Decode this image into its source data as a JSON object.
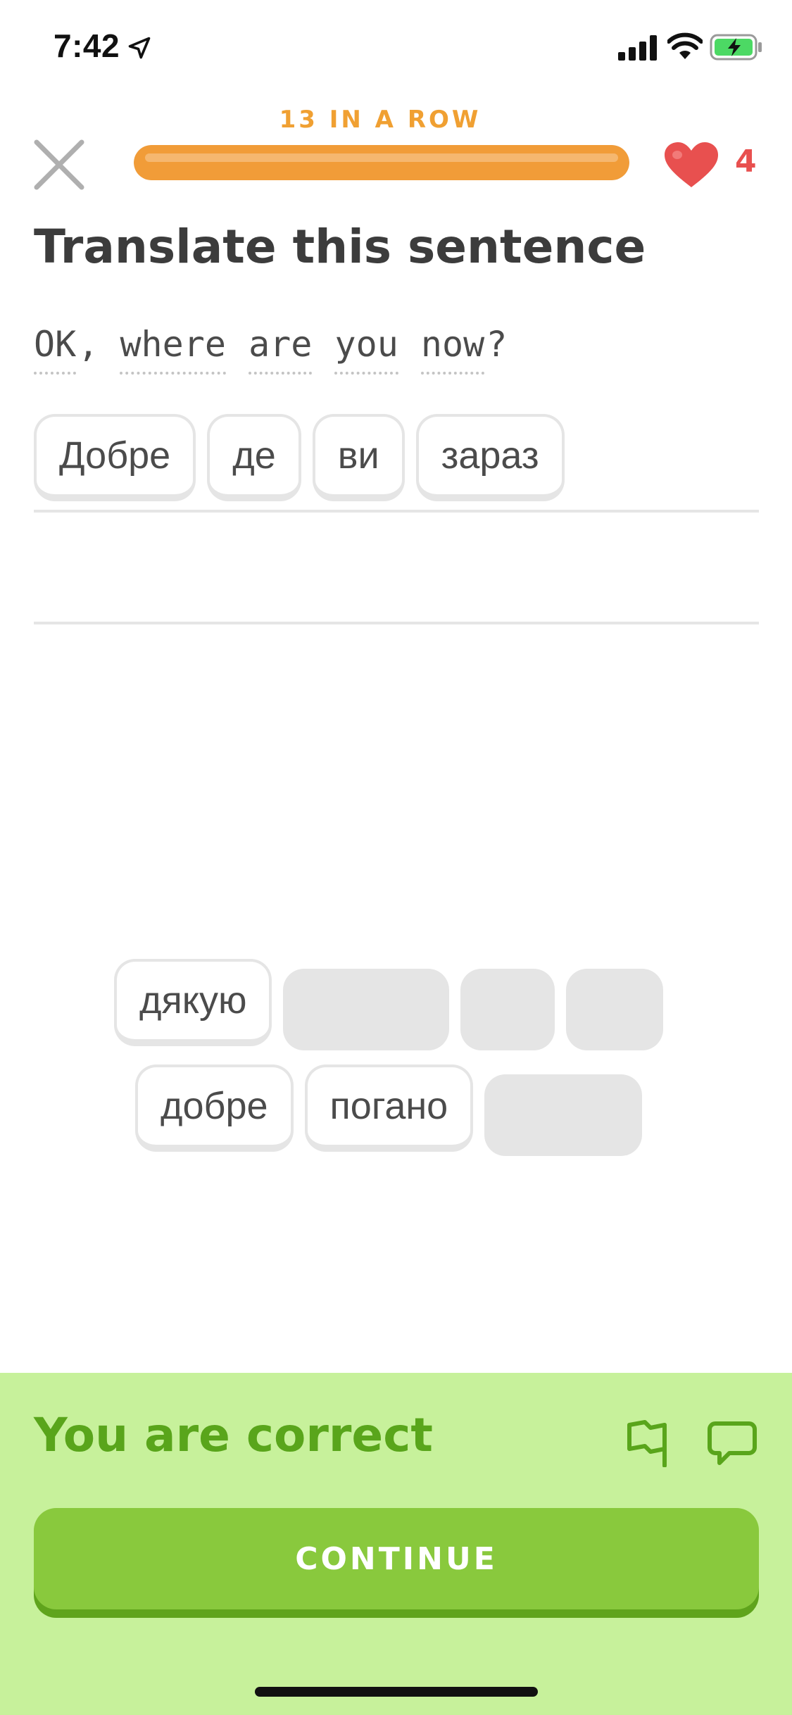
{
  "status_bar": {
    "time": "7:42",
    "icons": [
      "location-arrow-icon",
      "cellular-signal-icon",
      "wifi-icon",
      "battery-charging-icon"
    ]
  },
  "header": {
    "streak_text": "13 IN A ROW",
    "progress": 1.0,
    "hearts": "4",
    "colors": {
      "progress": "#f19c38",
      "streak": "#f0a032",
      "heart": "#e8504f"
    }
  },
  "prompt": {
    "title": "Translate this sentence",
    "sentence_words": [
      "OK",
      "where",
      "are",
      "you",
      "now"
    ],
    "sentence_punct": [
      ",",
      "?"
    ]
  },
  "answer": {
    "tiles": [
      "Добре",
      "де",
      "ви",
      "зараз"
    ]
  },
  "word_bank": {
    "row1": [
      {
        "text": "дякую",
        "used": false
      },
      {
        "text": "",
        "used": true
      },
      {
        "text": "",
        "used": true
      },
      {
        "text": "",
        "used": true
      }
    ],
    "row2": [
      {
        "text": "добре",
        "used": false
      },
      {
        "text": "погано",
        "used": false
      },
      {
        "text": "",
        "used": true
      }
    ]
  },
  "feedback": {
    "title": "You are correct",
    "continue_label": "CONTINUE",
    "colors": {
      "panel": "#c7f19b",
      "text": "#59a51b",
      "button": "#89c93d"
    }
  }
}
